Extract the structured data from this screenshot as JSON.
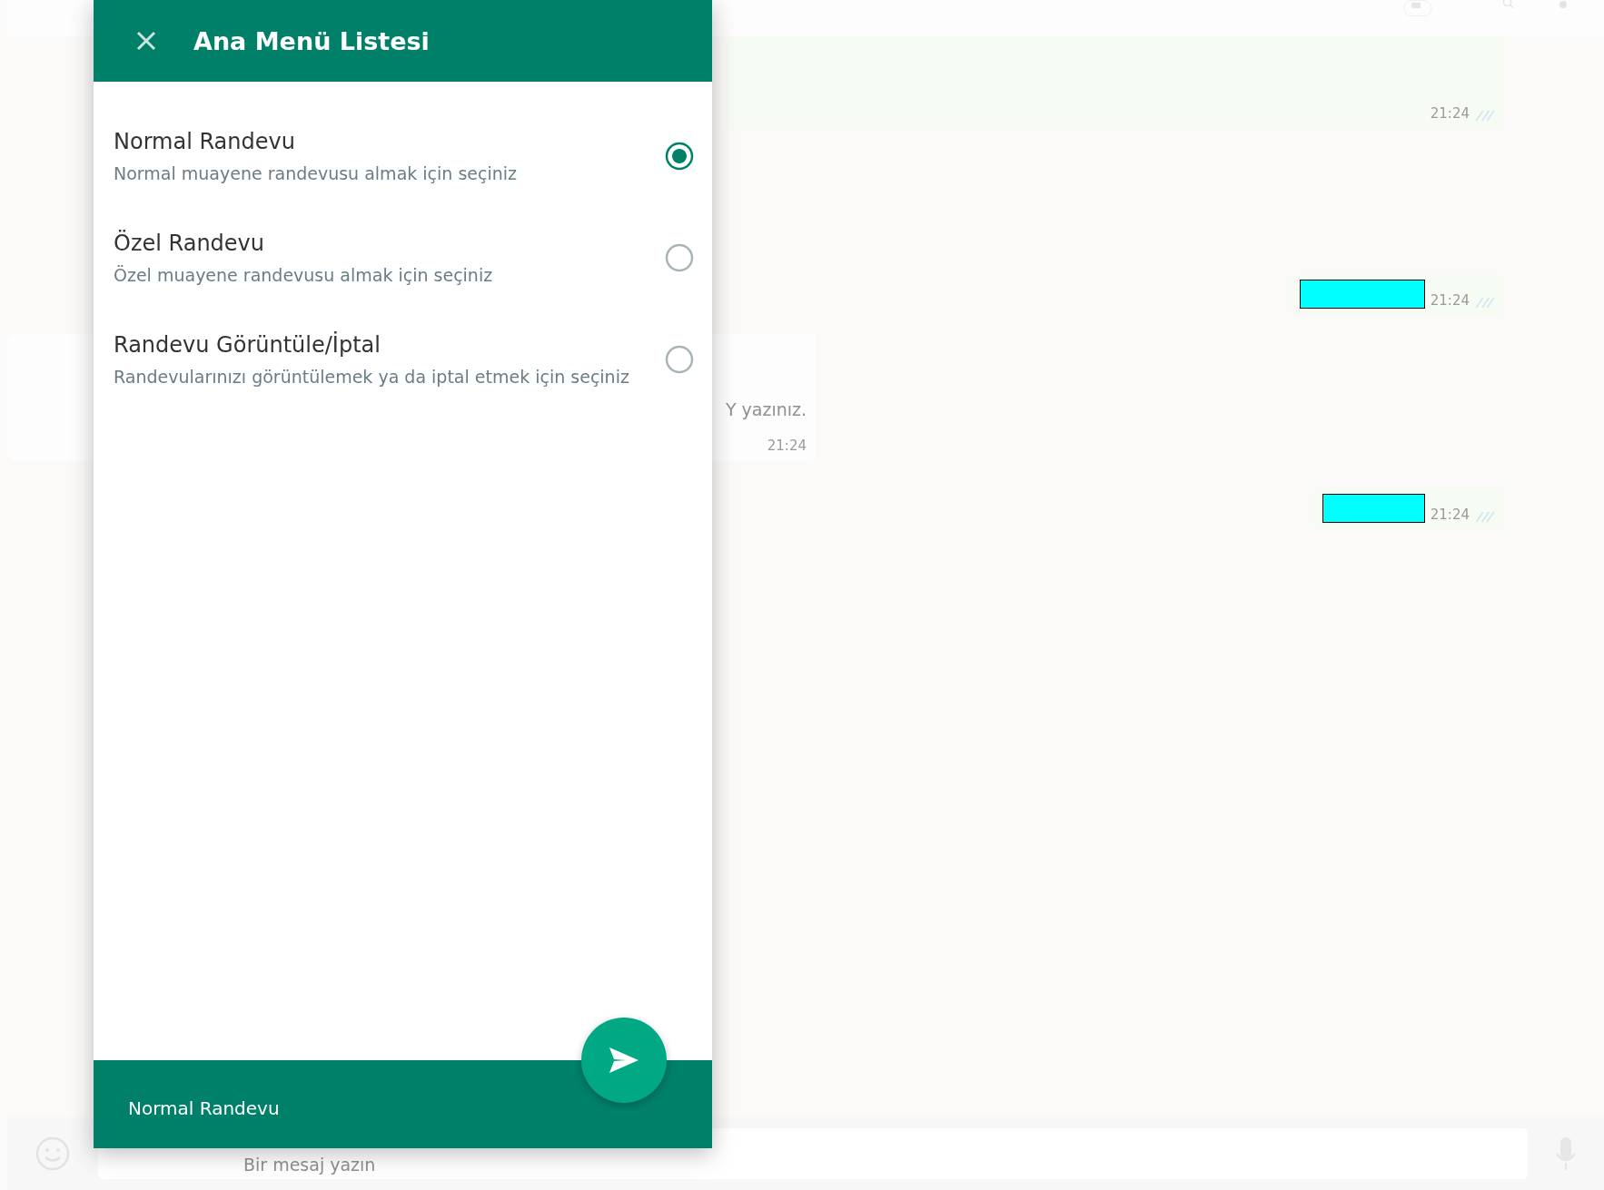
{
  "dialog": {
    "title": "Ana Menü Listesi",
    "options": [
      {
        "title": "Normal Randevu",
        "description": "Normal muayene randevusu almak için seçiniz",
        "selected": true
      },
      {
        "title": "Özel Randevu",
        "description": "Özel muayene randevusu almak için seçiniz",
        "selected": false
      },
      {
        "title": "Randevu Görüntüle/İptal",
        "description": "Randevularınızı görüntülemek ya da iptal etmek için seçiniz",
        "selected": false
      }
    ],
    "footer_selection": "Normal Randevu"
  },
  "chat": {
    "messages": [
      {
        "kind": "outgoing",
        "redacted": false,
        "time": "21:24"
      },
      {
        "kind": "outgoing",
        "redacted": true,
        "time": "21:24"
      },
      {
        "kind": "incoming",
        "text": "Y yazınız.",
        "time": "21:24"
      },
      {
        "kind": "outgoing",
        "redacted": true,
        "time": "21:24"
      }
    ],
    "composer": {
      "placeholder": "Bir mesaj yazın"
    }
  }
}
